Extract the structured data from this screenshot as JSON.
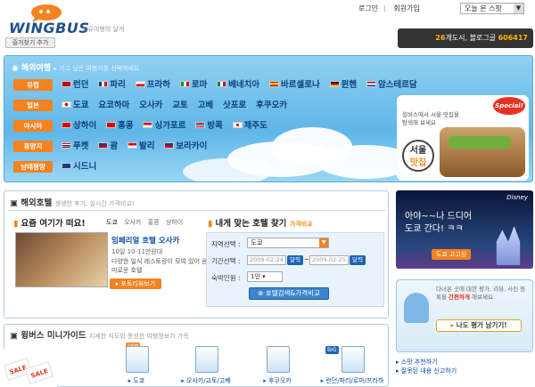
{
  "header": {
    "logo_text": "WINGBUS",
    "logo_tagline": "지유여행의 날개",
    "favorite_button": "즐겨찾기 추가",
    "links": [
      "로그인",
      "회원가입"
    ],
    "select_value": "오늘 본 스팟",
    "ticker_highlight": "26",
    "ticker_text": "개도시, 블로그글 ",
    "ticker_count": "606417"
  },
  "travel": {
    "title": "해외여행",
    "subtitle": "가고 싶은 여행지를 선택하세요.",
    "regions": [
      {
        "label": "유럽",
        "cities": [
          "런던",
          "파리",
          "프라하",
          "로마",
          "베네치아",
          "바르셀로나",
          "뮌헨",
          "암스테르담"
        ]
      },
      {
        "label": "일본",
        "cities": [
          "도쿄",
          "요코하마",
          "오사카",
          "교토",
          "고베",
          "삿포로",
          "후쿠오카"
        ]
      },
      {
        "label": "아시아",
        "cities": [
          "상하이",
          "홍콩",
          "싱가포르",
          "방콕",
          "제주도"
        ]
      },
      {
        "label": "휴양지",
        "cities": [
          "푸켓",
          "괌",
          "발리",
          "보라카이"
        ]
      },
      {
        "label": "남태평양",
        "cities": [
          "시드니"
        ]
      }
    ],
    "special": {
      "badge": "Special!",
      "text": "윙버스에서 서울 맛집을 탐색해 보세요",
      "big_line1": "서울",
      "big_line2": "맛집"
    }
  },
  "hotel": {
    "title": "해외호텔",
    "subtitle": "생생한 후기, 실시간 가격비교!",
    "recent_title": "요즘 여기가 떠요!",
    "tabs": [
      "도쿄",
      "오사카",
      "홍콩",
      "상하이"
    ],
    "featured_name": "임페리얼 호텔 오사카",
    "featured_date": "10일 10-11만원대",
    "featured_desc": "다양한 일식 레스토랑이 모여 있어 음미로운 호텔",
    "photo_button": "포토리뷰보기",
    "finder_title": "내게 맞는 호텔 찾기",
    "finder_hint": "가격비교",
    "dest_label": "지역선택 :",
    "dest_value": "도쿄",
    "period_label": "기간선택 :",
    "checkin": "2009-02-24",
    "checkout": "2009-02-25",
    "cal_label": "달력",
    "date_sep": "~",
    "guests_label": "숙박인원 :",
    "guests_value": "1인",
    "compare_button": "호텔검색&가격비교"
  },
  "ad": {
    "brand": "Disney",
    "line1": "아야~~나 드디어",
    "line2": "도쿄 간다! ㅋㅋ",
    "button": "도쿄 고고싱"
  },
  "review": {
    "text_prefix": "다녀온 곳에 대한 평가, 리뷰, 사진 등록을",
    "text_bold": "간편하게",
    "text_suffix": "해보세요",
    "button": "나도 평가 남기기!",
    "links": [
      "스팟 추천하기",
      "잘못된 내용 신고하기"
    ]
  },
  "guide": {
    "title": "윙버스 미니가이드",
    "subtitle": "지세한 지도와 풍성한 여행정보가 가득",
    "new_tag": "new",
    "big_tag": "BIG",
    "items": [
      "도쿄",
      "오사카/교토/고베",
      "후쿠오카",
      "런던/파리/로마/프라하"
    ],
    "sale_text": "SALE"
  },
  "colors": {
    "accent": "#f4821f",
    "brand": "#1e4f8a",
    "sky": "#5fb6e8"
  }
}
